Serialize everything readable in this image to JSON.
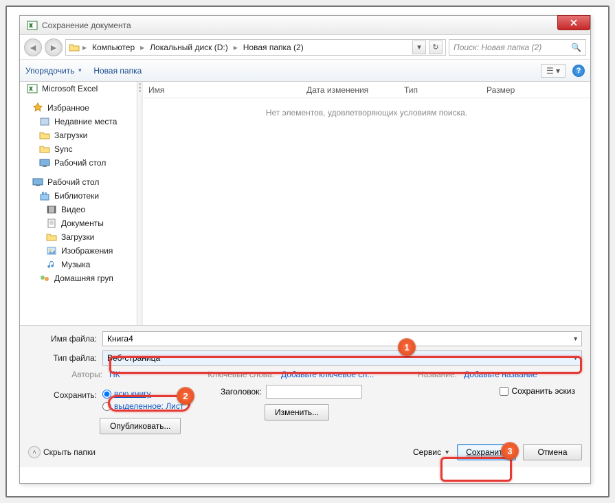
{
  "window": {
    "title": "Сохранение документа"
  },
  "nav": {
    "crumbs": [
      "Компьютер",
      "Локальный диск (D:)",
      "Новая папка (2)"
    ],
    "search_placeholder": "Поиск: Новая папка (2)"
  },
  "toolbar": {
    "organize": "Упорядочить",
    "new_folder": "Новая папка"
  },
  "sidebar": {
    "excel": "Microsoft Excel",
    "favorites": "Избранное",
    "fav_items": [
      "Недавние места",
      "Загрузки",
      "Sync",
      "Рабочий стол"
    ],
    "desktop": "Рабочий стол",
    "libraries": "Библиотеки",
    "lib_items": [
      "Видео",
      "Документы",
      "Загрузки",
      "Изображения",
      "Музыка"
    ],
    "homegroup": "Домашняя груп"
  },
  "filelist": {
    "cols": {
      "name": "Имя",
      "date": "Дата изменения",
      "type": "Тип",
      "size": "Размер"
    },
    "empty": "Нет элементов, удовлетворяющих условиям поиска."
  },
  "fields": {
    "filename_label": "Имя файла:",
    "filename_value": "Книга4",
    "filetype_label": "Тип файла:",
    "filetype_value": "Веб-страница",
    "authors_label": "Авторы:",
    "authors_value": "ПК",
    "keywords_label": "Ключевые слова:",
    "keywords_value": "Добавьте ключевое сл...",
    "title_label": "Название:",
    "title_value": "Добавьте название",
    "save_label": "Сохранить:",
    "radio_whole": "всю книгу",
    "radio_selection_pre": "выделенное: ",
    "radio_selection_sheet": "Лист",
    "page_title_label": "Заголовок:",
    "change_btn": "Изменить...",
    "thumbnail": "Сохранить эскиз",
    "publish_btn": "Опубликовать..."
  },
  "footer": {
    "hide": "Скрыть папки",
    "service": "Сервис",
    "save": "Сохранить",
    "cancel": "Отмена"
  },
  "annotations": {
    "b1": "1",
    "b2": "2",
    "b3": "3"
  }
}
